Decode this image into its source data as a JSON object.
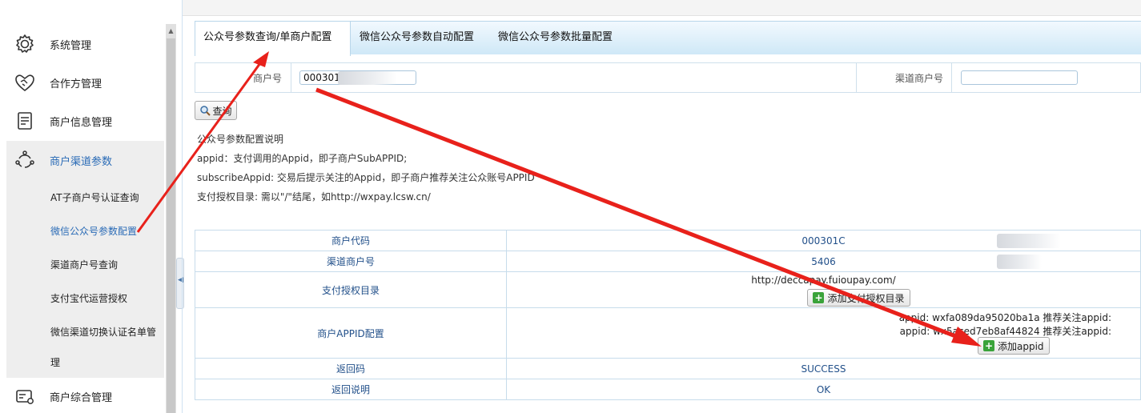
{
  "sidebar": {
    "items": [
      {
        "label": "系统管理",
        "icon": "gear-icon"
      },
      {
        "label": "合作方管理",
        "icon": "handshake-icon"
      },
      {
        "label": "商户信息管理",
        "icon": "document-list-icon"
      },
      {
        "label": "商户渠道参数",
        "icon": "channel-nodes-icon"
      },
      {
        "label": "商户综合管理",
        "icon": "card-settings-icon"
      }
    ],
    "sub_items": [
      {
        "label": "AT子商户号认证查询"
      },
      {
        "label": "微信公众号参数配置"
      },
      {
        "label": "渠道商户号查询"
      },
      {
        "label": "支付宝代运营授权"
      },
      {
        "label": "微信渠道切换认证名单管"
      },
      {
        "label": "理"
      }
    ]
  },
  "tabs": [
    {
      "label": "公众号参数查询/单商户配置"
    },
    {
      "label": "微信公众号参数自动配置"
    },
    {
      "label": "微信公众号参数批量配置"
    }
  ],
  "search": {
    "merchant_label": "商户号",
    "merchant_value": "000301C",
    "channel_label": "渠道商户号",
    "channel_value": ""
  },
  "query_button": {
    "label": "查询"
  },
  "notes": [
    "公众号参数配置说明",
    "appid：支付调用的Appid，即子商户SubAPPID;",
    "subscribeAppid: 交易后提示关注的Appid，即子商户推荐关注公众账号APPID",
    "支付授权目录: 需以\"/\"结尾，如http://wxpay.lcsw.cn/"
  ],
  "result": {
    "merchant_code_label": "商户代码",
    "merchant_code_value": "000301C",
    "channel_no_label": "渠道商户号",
    "channel_no_value": "5406",
    "pay_dir_label": "支付授权目录",
    "pay_dir_value": "http://deccapay.fuioupay.com/",
    "add_pay_dir_button": "添加支付授权目录",
    "appid_label": "商户APPID配置",
    "appid_line1": "appid:  wxfa089da95020ba1a    推荐关注appid:",
    "appid_line2": "appid:  wx5aced7eb8af44824    推荐关注appid:",
    "add_appid_button": "添加appid",
    "return_code_label": "返回码",
    "return_code_value": "SUCCESS",
    "return_msg_label": "返回说明",
    "return_msg_value": "OK"
  },
  "colors": {
    "accent": "#2a6bb6",
    "annotation_arrow": "#e8211b",
    "tab_gradient": "#cfe8f7"
  }
}
